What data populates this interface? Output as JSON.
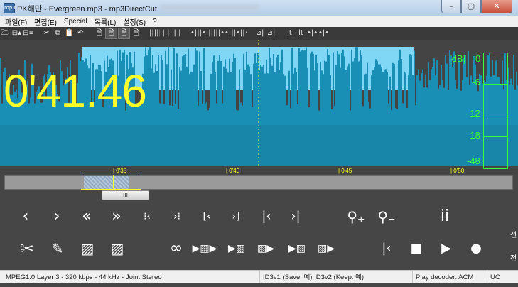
{
  "window": {
    "title": "PK해만 - Evergreen.mp3 - mp3DirectCut",
    "app_icon_text": "mp3",
    "minimize": "–",
    "maximize": "▢",
    "close": "✕"
  },
  "menu": [
    "파일(F)",
    "편집(E)",
    "Special",
    "목록(L)",
    "설정(S)",
    "?"
  ],
  "toolbar": [
    {
      "icon": "open-icon",
      "glyph": "🗁"
    },
    {
      "icon": "save-icon",
      "glyph": "⊟▴"
    },
    {
      "icon": "save-all-icon",
      "glyph": "⊟≡"
    },
    {
      "icon": "gap"
    },
    {
      "icon": "cut-icon",
      "glyph": "✂"
    },
    {
      "icon": "copy-icon",
      "glyph": "⧉"
    },
    {
      "icon": "paste-icon",
      "glyph": "📋"
    },
    {
      "icon": "undo-icon",
      "glyph": "↶"
    },
    {
      "icon": "gap"
    },
    {
      "icon": "page-icon",
      "glyph": "🗎"
    },
    {
      "icon": "page-a-icon",
      "glyph": "🗎",
      "selected": true
    },
    {
      "icon": "page-b-icon",
      "glyph": "🗎",
      "selected": true
    },
    {
      "icon": "page-c-icon",
      "glyph": "🗎"
    },
    {
      "icon": "gap"
    },
    {
      "icon": "bars-icon",
      "glyph": "|||||"
    },
    {
      "icon": "bars-small-icon",
      "glyph": "|||"
    },
    {
      "icon": "pause-icon",
      "glyph": "| |"
    },
    {
      "icon": "gap"
    },
    {
      "icon": "mark-left-icon",
      "glyph": "•|||"
    },
    {
      "icon": "mark-left2-icon",
      "glyph": "•|||"
    },
    {
      "icon": "mark-right-icon",
      "glyph": "|||•"
    },
    {
      "icon": "mark-mid-icon",
      "glyph": "•|||•"
    },
    {
      "icon": "mark-mid2-icon",
      "glyph": "•||•"
    },
    {
      "icon": "gap"
    },
    {
      "icon": "split-icon",
      "glyph": "⊿|"
    },
    {
      "icon": "split2-icon",
      "glyph": "⊿|"
    },
    {
      "icon": "gap"
    },
    {
      "icon": "lt-icon",
      "glyph": "lt"
    },
    {
      "icon": "lt2-icon",
      "glyph": "lt"
    },
    {
      "icon": "join-icon",
      "glyph": "•|•"
    },
    {
      "icon": "join2-icon",
      "glyph": "•|•"
    }
  ],
  "display": {
    "timecode": "0'41.46",
    "db_unit": "[dB]",
    "db_scale": [
      "0",
      "-6",
      "-12",
      "-18",
      "-48"
    ],
    "ruler": [
      "| 0'35",
      "| 0'40",
      "| 0'45",
      "| 0'50"
    ]
  },
  "overview": {
    "scroll_thumb": "III"
  },
  "transport_row1": [
    {
      "name": "prev-icon",
      "glyph": "‹"
    },
    {
      "name": "next-icon",
      "glyph": "›"
    },
    {
      "name": "rewind-icon",
      "glyph": "«"
    },
    {
      "name": "fast-forward-icon",
      "glyph": "»"
    },
    {
      "name": "to-selection-start-icon",
      "glyph": "⁝‹"
    },
    {
      "name": "to-selection-end-icon",
      "glyph": "›⁝"
    },
    {
      "name": "selection-left-icon",
      "glyph": "[‹"
    },
    {
      "name": "selection-right-icon",
      "glyph": "›]"
    },
    {
      "name": "to-start-icon",
      "glyph": "|‹"
    },
    {
      "name": "to-end-icon",
      "glyph": "›|"
    },
    {
      "name": "zoom-in-icon",
      "glyph": "⚲₊"
    },
    {
      "name": "zoom-out-icon",
      "glyph": "⚲₋"
    },
    {
      "name": "info-icon",
      "glyph": "ii"
    }
  ],
  "transport_row2": [
    {
      "name": "scissors-icon",
      "glyph": "✂"
    },
    {
      "name": "pencil-icon",
      "glyph": "✎"
    },
    {
      "name": "hatch-icon",
      "glyph": "▨"
    },
    {
      "name": "hatch-outline-icon",
      "glyph": "▨"
    },
    {
      "name": "loop-icon",
      "glyph": "∞"
    },
    {
      "name": "play-selection-icon",
      "glyph": "▶▨▶"
    },
    {
      "name": "play-selection-start-icon",
      "glyph": "▶▨"
    },
    {
      "name": "play-selection-end-icon",
      "glyph": "▨▶"
    },
    {
      "name": "play-selection-both-icon",
      "glyph": "▶▨"
    },
    {
      "name": "play-selection-after-icon",
      "glyph": "▨▶"
    },
    {
      "name": "skip-back-icon",
      "glyph": "|‹"
    },
    {
      "name": "stop-icon",
      "glyph": "■"
    },
    {
      "name": "play-icon",
      "glyph": "▶"
    },
    {
      "name": "record-icon",
      "glyph": "●"
    }
  ],
  "side_text": [
    "선",
    "전"
  ],
  "status": {
    "format": "MPEG1.0 Layer 3 - 320 kbps - 44 kHz - Joint Stereo",
    "id3": "ID3v1 (Save: 예)  ID3v2 (Keep: 예)",
    "decoder": "Play decoder: ACM",
    "mode": "UC"
  },
  "colors": {
    "wave": "#1a8fb5",
    "wave_selected": "#7fd6f5",
    "timecode": "#ffff2a",
    "vu": "#3cff3c",
    "background": "#464646"
  }
}
